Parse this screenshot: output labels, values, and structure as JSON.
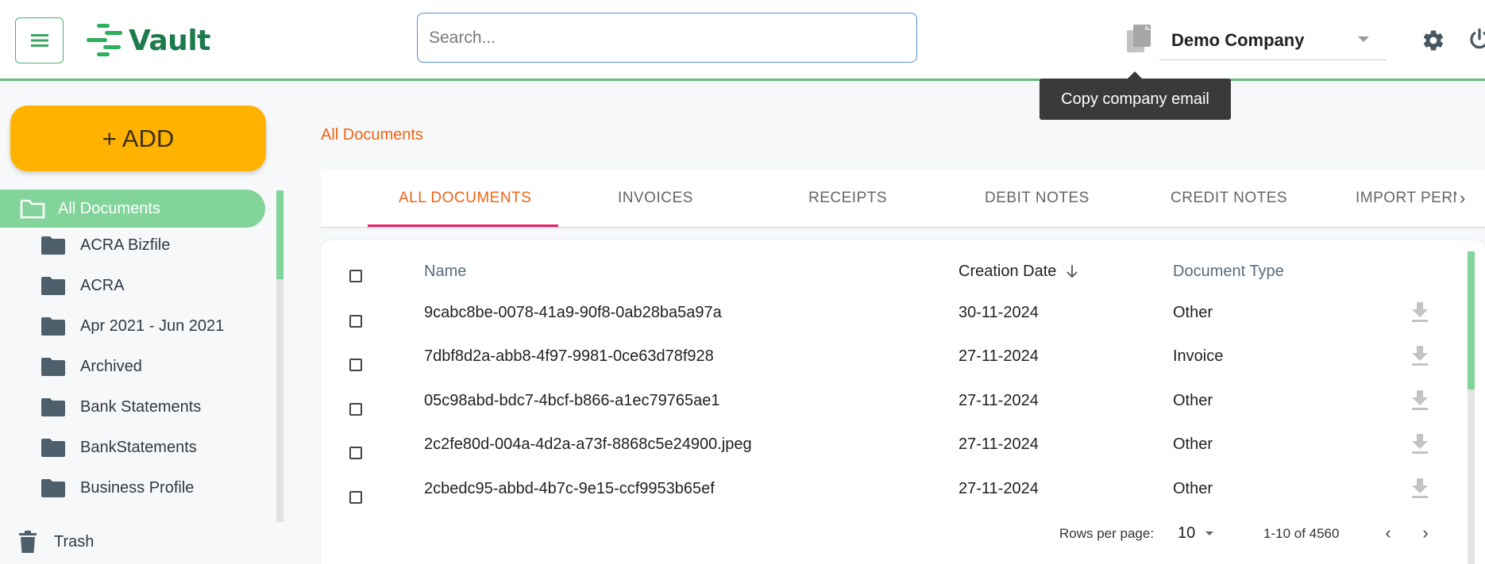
{
  "app": {
    "name": "Vault"
  },
  "header": {
    "search_placeholder": "Search...",
    "company": "Demo Company",
    "tooltip": "Copy company email"
  },
  "sidebar": {
    "add_label": "+ ADD",
    "active": "All Documents",
    "folders": [
      "ACRA Bizfile",
      "ACRA",
      "Apr 2021 - Jun 2021",
      "Archived",
      "Bank Statements",
      "BankStatements",
      "Business Profile"
    ],
    "trash": "Trash"
  },
  "main": {
    "breadcrumb": "All Documents",
    "tabs": [
      "ALL DOCUMENTS",
      "INVOICES",
      "RECEIPTS",
      "DEBIT NOTES",
      "CREDIT NOTES",
      "IMPORT PERMITS"
    ],
    "active_tab": 0,
    "columns": {
      "name": "Name",
      "date": "Creation Date",
      "type": "Document Type"
    },
    "rows": [
      {
        "name": "9cabc8be-0078-41a9-90f8-0ab28ba5a97a",
        "date": "30-11-2024",
        "type": "Other"
      },
      {
        "name": "7dbf8d2a-abb8-4f97-9981-0ce63d78f928",
        "date": "27-11-2024",
        "type": "Invoice"
      },
      {
        "name": "05c98abd-bdc7-4bcf-b866-a1ec79765ae1",
        "date": "27-11-2024",
        "type": "Other"
      },
      {
        "name": "2c2fe80d-004a-4d2a-a73f-8868c5e24900.jpeg",
        "date": "27-11-2024",
        "type": "Other"
      },
      {
        "name": "2cbedc95-abbd-4b7c-9e15-ccf9953b65ef",
        "date": "27-11-2024",
        "type": "Other"
      }
    ],
    "pagination": {
      "rows_per_page_label": "Rows per page:",
      "rows_per_page": "10",
      "range": "1-10 of 4560"
    }
  },
  "colors": {
    "accent_green": "#82d49a",
    "add_yellow": "#ffb300",
    "active_orange": "#f06414",
    "tab_ink": "#e91e63"
  }
}
